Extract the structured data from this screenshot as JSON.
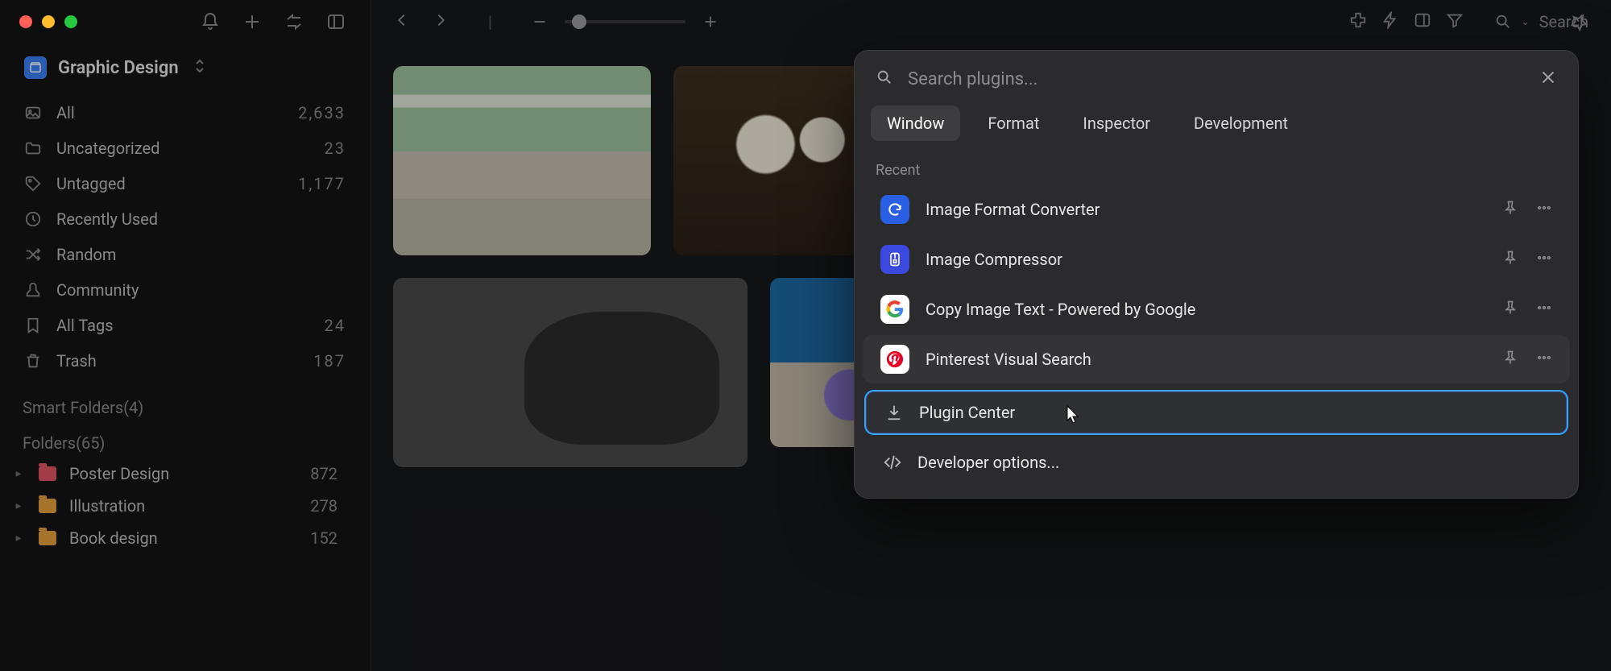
{
  "library": {
    "name": "Graphic Design"
  },
  "sidebar": {
    "items": [
      {
        "label": "All",
        "count": "2,633"
      },
      {
        "label": "Uncategorized",
        "count": "23"
      },
      {
        "label": "Untagged",
        "count": "1,177"
      },
      {
        "label": "Recently Used",
        "count": ""
      },
      {
        "label": "Random",
        "count": ""
      },
      {
        "label": "Community",
        "count": ""
      },
      {
        "label": "All Tags",
        "count": "24"
      },
      {
        "label": "Trash",
        "count": "187"
      }
    ],
    "smart_folders_label": "Smart Folders(4)",
    "folders_label": "Folders(65)",
    "folders": [
      {
        "label": "Poster Design",
        "count": "872",
        "color": "#e25563"
      },
      {
        "label": "Illustration",
        "count": "278",
        "color": "#e7a13c"
      },
      {
        "label": "Book design",
        "count": "152",
        "color": "#e7a13c"
      }
    ]
  },
  "toolbar": {
    "search_placeholder": "Search"
  },
  "pluginPanel": {
    "search_placeholder": "Search plugins...",
    "tabs": [
      {
        "label": "Window",
        "active": true
      },
      {
        "label": "Format",
        "active": false
      },
      {
        "label": "Inspector",
        "active": false
      },
      {
        "label": "Development",
        "active": false
      }
    ],
    "recent_label": "Recent",
    "plugins": [
      {
        "label": "Image Format Converter"
      },
      {
        "label": "Image Compressor"
      },
      {
        "label": "Copy Image Text - Powered by Google"
      },
      {
        "label": "Pinterest Visual Search"
      }
    ],
    "footer": {
      "plugin_center": "Plugin Center",
      "developer_options": "Developer options..."
    }
  }
}
